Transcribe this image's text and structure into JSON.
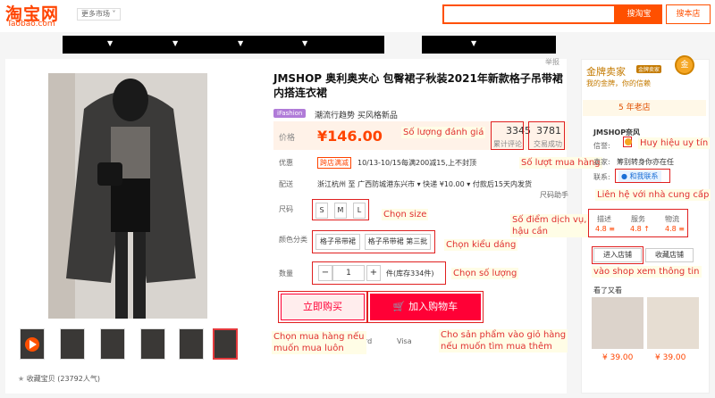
{
  "header": {
    "logo_cn": "淘宝网",
    "logo_en": "Taobao.com",
    "market": "更多市场 ˅",
    "search_btn": "搜淘宝",
    "search_store_btn": "搜本店"
  },
  "report": "举报",
  "product": {
    "title": "JMSHOP 奥利奥夹心 包臀裙子秋装2021年新款格子吊带裙内搭连衣裙",
    "badge": "iFashion",
    "subtitle": "潮流行趋势 买风格新品",
    "price_label": "价格",
    "price": "¥146.00",
    "reviews_num": "3345",
    "reviews_lbl": "累计评论",
    "sales_num": "3781",
    "sales_lbl": "交易成功",
    "promo_label": "优惠",
    "promo_tag": "跨店满减",
    "promo_text": "10/13-10/15每满200减15,上不封顶",
    "ship_label": "配送",
    "ship_text": "浙江杭州 至  广西防城港东兴市  ▾   快递 ¥10.00  ▾   付款后15天内发货",
    "size_helper": "尺码助手",
    "size_label": "尺码",
    "sizes": [
      "S",
      "M",
      "L"
    ],
    "color_label": "颜色分类",
    "colors": [
      "格子吊带裙",
      "格子吊带裙 第三批"
    ],
    "qty_label": "数量",
    "qty_minus": "−",
    "qty_value": "1",
    "qty_plus": "+",
    "stock": "件(库存334件)",
    "buy_now": "立即购买",
    "add_cart": "加入购物车",
    "pay_card": "rd",
    "pay_visa": "Visa",
    "favorite": "收藏宝贝 (23792人气)"
  },
  "annotations": {
    "reviews": "Số lượng đánh giá",
    "sales": "Số lượt mua hàng",
    "size": "Chọn size",
    "color": "Chọn kiểu dáng",
    "qty": "Chọn số lượng",
    "buy": "Chọn mua hàng nếu\nmuốn mua luôn",
    "cart": "Cho sản phẩm vào giỏ hàng\nnếu muốn tìm mua thêm",
    "trust": "Huy hiệu uy tín",
    "contact": "Liên hệ với nhà cung cấp",
    "scores": "Số điểm dịch vụ,\nhậu cần",
    "enter": "vào shop xem thông tin"
  },
  "seller": {
    "gold_title": "金牌卖家",
    "gold_badge": "金牌卖家",
    "gold_slogan": "我的金牌，你的信赖",
    "medal": "金",
    "years": "5 年老店",
    "shop_name": "JMSHOP奈风",
    "credit_label": "信誉:",
    "seller_label": "卖家:",
    "seller_value": "筹别转身你亦在任",
    "contact_label": "联系:",
    "contact_value": "和我联系",
    "score_heads": [
      "描述",
      "服务",
      "物流"
    ],
    "score_vals": [
      "4.8 ≡",
      "4.8 ↑",
      "4.8 ≡"
    ],
    "enter_store": "进入店铺",
    "fav_store": "收藏店铺",
    "seen": "看了又看",
    "side_prices": [
      "¥ 39.00",
      "¥ 39.00"
    ]
  }
}
